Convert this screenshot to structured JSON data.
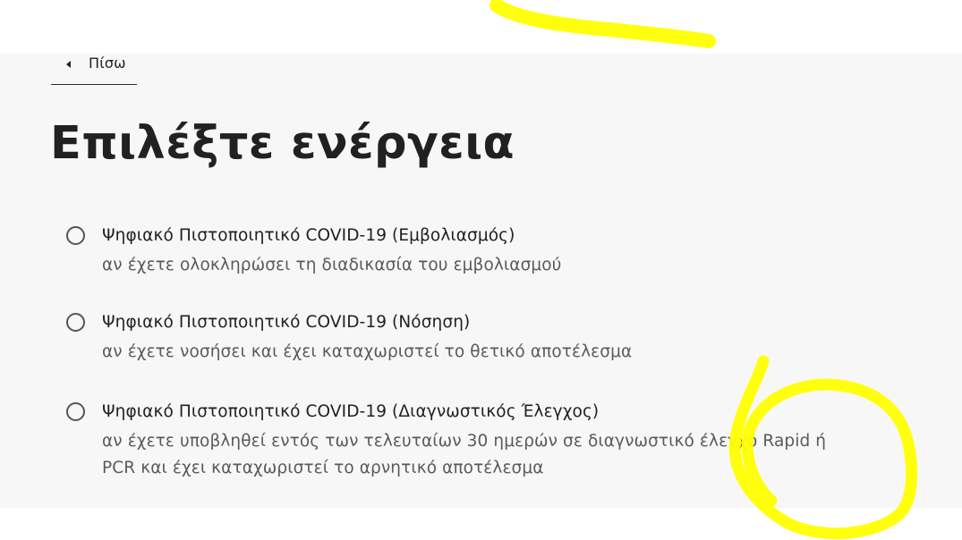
{
  "back": {
    "label": "Πίσω"
  },
  "title": "Επιλέξτε ενέργεια",
  "options": [
    {
      "label": "Ψηφιακό Πιστοποιητικό COVID-19 (Εμβολιασμός)",
      "hint": "αν έχετε ολοκληρώσει τη διαδικασία του εμβολιασμού",
      "selected": false
    },
    {
      "label": "Ψηφιακό Πιστοποιητικό COVID-19 (Νόσηση)",
      "hint": "αν έχετε νοσήσει και έχει καταχωριστεί το θετικό αποτέλεσμα",
      "selected": false
    },
    {
      "label": "Ψηφιακό Πιστοποιητικό COVID-19 (Διαγνωστικός Έλεγχος)",
      "hint": "αν έχετε υποβληθεί εντός των τελευταίων 30 ημερών σε διαγνωστικό έλεγχο Rapid ή PCR και έχει καταχωριστεί το αρνητικό αποτέλεσμα",
      "selected": false
    }
  ],
  "annotation": {
    "color": "#ffff00"
  }
}
